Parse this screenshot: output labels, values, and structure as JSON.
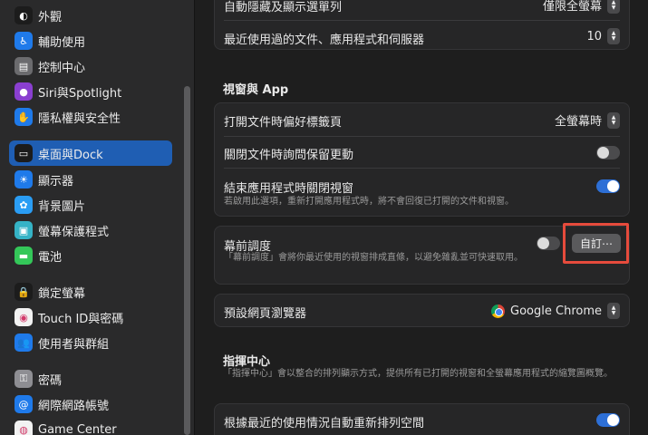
{
  "sidebar": {
    "items": [
      {
        "label": "外觀",
        "icon": "appearance-icon",
        "color": "#1c1c1c",
        "glyph": "◐"
      },
      {
        "label": "輔助使用",
        "icon": "accessibility-icon",
        "color": "#1f7aea",
        "glyph": "♿"
      },
      {
        "label": "控制中心",
        "icon": "control-center-icon",
        "color": "#6b6b6e",
        "glyph": "▤"
      },
      {
        "label": "Siri與Spotlight",
        "icon": "siri-icon",
        "color": "#8a3fd0",
        "glyph": "●"
      },
      {
        "label": "隱私權與安全性",
        "icon": "privacy-hand-icon",
        "color": "#1f7aea",
        "glyph": "✋"
      },
      {
        "label": "桌面與Dock",
        "icon": "desktop-dock-icon",
        "color": "#1c1c1c",
        "glyph": "▭"
      },
      {
        "label": "顯示器",
        "icon": "display-icon",
        "color": "#1f7aea",
        "glyph": "☀"
      },
      {
        "label": "背景圖片",
        "icon": "wallpaper-icon",
        "color": "#2a9df4",
        "glyph": "✿"
      },
      {
        "label": "螢幕保護程式",
        "icon": "screensaver-icon",
        "color": "#35b3c6",
        "glyph": "▣"
      },
      {
        "label": "電池",
        "icon": "battery-icon",
        "color": "#34c759",
        "glyph": "▬"
      },
      {
        "label": "鎖定螢幕",
        "icon": "lock-screen-icon",
        "color": "#1c1c1c",
        "glyph": "🔒"
      },
      {
        "label": "Touch ID與密碼",
        "icon": "fingerprint-icon",
        "color": "#f2f2f2",
        "glyph": "◉"
      },
      {
        "label": "使用者與群組",
        "icon": "users-groups-icon",
        "color": "#1f7aea",
        "glyph": "👥"
      },
      {
        "label": "密碼",
        "icon": "key-icon",
        "color": "#8e8e93",
        "glyph": "⚿"
      },
      {
        "label": "網際網路帳號",
        "icon": "internet-accounts-icon",
        "color": "#1f7aea",
        "glyph": "@"
      },
      {
        "label": "Game Center",
        "icon": "game-center-icon",
        "color": "#f2f2f2",
        "glyph": "◍"
      }
    ],
    "selected_index": 5
  },
  "main": {
    "top_card": {
      "row1_label": "自動隱藏及顯示選單列",
      "row1_value": "僅限全螢幕",
      "row2_label": "最近使用過的文件、應用程式和伺服器",
      "row2_value": "10"
    },
    "windows_section_title": "視窗與 App",
    "windows_card": {
      "tabs_label": "打開文件時偏好標籤頁",
      "tabs_value": "全螢幕時",
      "ask_keep_label": "關閉文件時詢問保留更動",
      "ask_keep_on": false,
      "close_windows_label": "結束應用程式時關閉視窗",
      "close_windows_sub": "若啟用此選項，重新打開應用程式時，將不會回復已打開的文件和視窗。",
      "close_windows_on": true
    },
    "stage_manager": {
      "label": "幕前調度",
      "sub": "「幕前調度」會將你最近使用的視窗排成直條，以避免雜亂並可快速取用。",
      "on": false,
      "customize_label": "自訂⋯"
    },
    "browser": {
      "label": "預設網頁瀏覽器",
      "value": "Google Chrome"
    },
    "mission_control": {
      "title": "指揮中心",
      "sub": "「指揮中心」會以整合的排列顯示方式，提供所有已打開的視窗和全螢幕應用程式的縮覽圖概覽。",
      "auto_rearrange_label": "根據最近的使用情況自動重新排列空間",
      "auto_rearrange_on": true
    }
  },
  "colors": {
    "accent": "#2d6fd6",
    "selection": "#1f5eb3",
    "highlight_box": "#e64b3c"
  }
}
